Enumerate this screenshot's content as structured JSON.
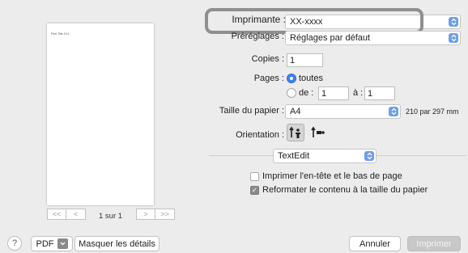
{
  "preview": {
    "header_text": "Print Title 13.9",
    "first_label": "<<",
    "prev_label": "<",
    "status": "1 sur 1",
    "next_label": ">",
    "last_label": ">>"
  },
  "printer": {
    "label": "Imprimante :",
    "value": "XX-xxxx"
  },
  "presets": {
    "label": "Préréglages :",
    "value": "Réglages par défaut"
  },
  "copies": {
    "label": "Copies :",
    "value": "1"
  },
  "pages": {
    "label": "Pages :",
    "all_label": "toutes",
    "from_label": "de :",
    "from_value": "1",
    "to_label": "à :",
    "to_value": "1",
    "selected": "all"
  },
  "paper_size": {
    "label": "Taille du papier :",
    "value": "A4",
    "dimensions": "210 par 297 mm"
  },
  "orientation": {
    "label": "Orientation :",
    "selected": "portrait"
  },
  "app_menu": {
    "value": "TextEdit"
  },
  "options": {
    "header_footer": {
      "label": "Imprimer l'en-tête et le bas de page",
      "checked": false
    },
    "reflow": {
      "label": "Reformater le contenu à la taille du papier",
      "checked": true
    }
  },
  "footer": {
    "help_label": "?",
    "pdf_label": "PDF",
    "details_label": "Masquer les détails",
    "cancel_label": "Annuler",
    "print_label": "Imprimer"
  },
  "colors": {
    "accent": "#3b82f0",
    "highlight_border": "#8f8f8f",
    "background": "#ececec"
  }
}
